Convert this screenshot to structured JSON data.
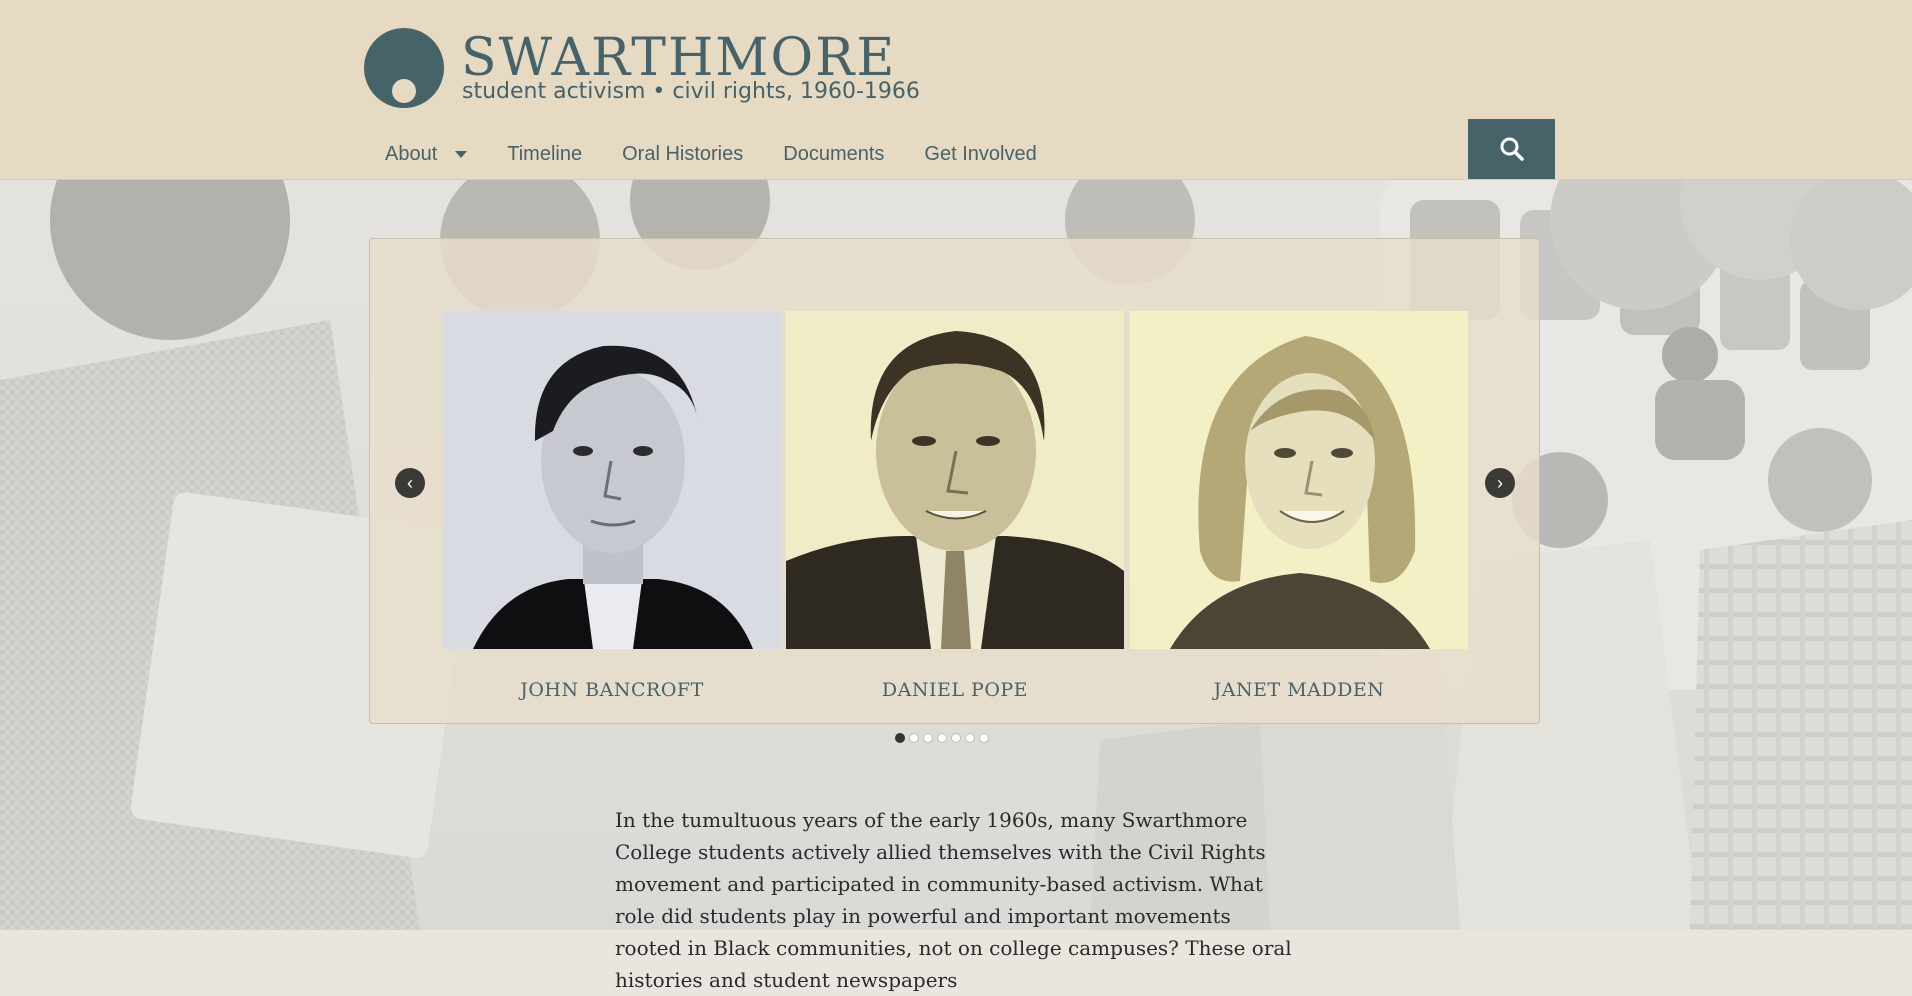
{
  "brand": {
    "name": "SWARTHMORE",
    "tagline": "student activism • civil rights, 1960-1966",
    "color": "#46636a"
  },
  "nav": {
    "items": [
      {
        "label": "About",
        "has_dropdown": true
      },
      {
        "label": "Timeline"
      },
      {
        "label": "Oral Histories"
      },
      {
        "label": "Documents"
      },
      {
        "label": "Get Involved"
      }
    ],
    "search_icon": "search-icon"
  },
  "carousel": {
    "slides": [
      {
        "name": "JOHN BANCROFT"
      },
      {
        "name": "DANIEL POPE"
      },
      {
        "name": "JANET MADDEN"
      }
    ],
    "prev_label": "‹",
    "next_label": "›",
    "dot_count": 7,
    "active_dot": 1
  },
  "intro": {
    "text": "In the tumultuous years of the early 1960s, many Swarthmore College students actively allied themselves with the Civil Rights movement and participated in community-based activism. What role did students play in powerful and important movements rooted in Black communities, not on college campuses? These oral histories and student newspapers"
  },
  "colors": {
    "header_bg": "#e6dac3",
    "accent": "#46636a"
  }
}
